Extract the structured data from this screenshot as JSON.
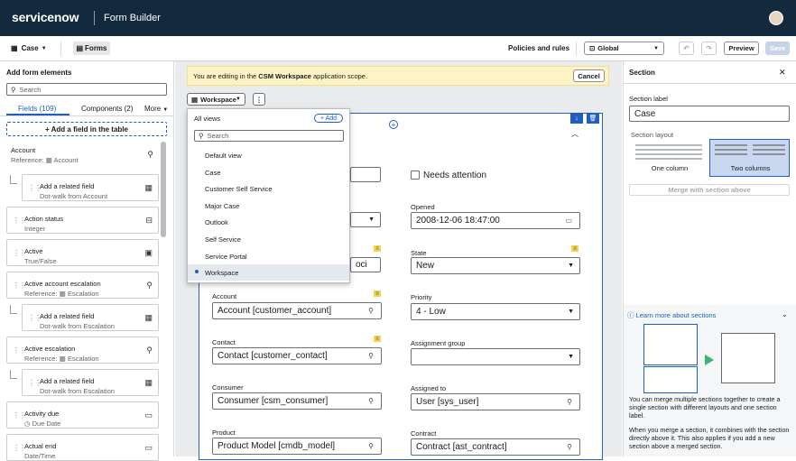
{
  "header": {
    "logo": "servicenow",
    "title": "Form Builder"
  },
  "toolbar": {
    "table": "Case",
    "forms": "Forms",
    "policies": "Policies and rules",
    "scope": "Global",
    "preview": "Preview",
    "save": "Save"
  },
  "left": {
    "title": "Add form elements",
    "search_placeholder": "Search",
    "tabs": [
      "Fields (109)",
      "Components (2)",
      "More"
    ],
    "add_field": "+ Add a field in the table",
    "items": [
      {
        "t1": "Account",
        "t2": "Reference:",
        "t3": "Account",
        "icon": "search-icon"
      },
      {
        "t1": "Add a related field",
        "t2": "Dot-walk from Account",
        "icon": "table-icon"
      },
      {
        "t1": "Action status",
        "t2": "Integer",
        "icon": "integer-icon"
      },
      {
        "t1": "Active",
        "t2": "True/False",
        "icon": "toggle-icon"
      },
      {
        "t1": "Active account escalation",
        "t2": "Reference:",
        "t3": "Escalation",
        "icon": "search-icon"
      },
      {
        "t1": "Add a related field",
        "t2": "Dot-walk from Escalation",
        "icon": "table-icon"
      },
      {
        "t1": "Active escalation",
        "t2": "Reference:",
        "t3": "Escalation",
        "icon": "search-icon"
      },
      {
        "t1": "Add a related field",
        "t2": "Dot-walk from Escalation",
        "icon": "table-icon"
      },
      {
        "t1": "Activity due",
        "t2": "Due Date",
        "icon": "calendar-icon"
      },
      {
        "t1": "Actual end",
        "t2": "Date/Time",
        "icon": "datetime-icon"
      }
    ]
  },
  "banner": {
    "pre": "You are editing in the ",
    "app": "CSM Workspace",
    "post": " application scope.",
    "cancel": "Cancel"
  },
  "view_select": "Workspace",
  "dropdown": {
    "title": "All views",
    "add": "+ Add",
    "search_placeholder": "Search",
    "items": [
      "Default view",
      "Case",
      "Customer Self Service",
      "Major Case",
      "Outlook",
      "Self Service",
      "Service Portal",
      "Workspace"
    ]
  },
  "form": {
    "needs_attention": "Needs attention",
    "opened_label": "Opened",
    "opened_value": "2008-12-06 18:47:00",
    "state_label": "State",
    "state_value": "New",
    "partial_value": "oci",
    "account_label": "Account",
    "account_value": "Account [customer_account]",
    "priority_label": "Priority",
    "priority_value": "4 - Low",
    "contact_label": "Contact",
    "contact_value": "Contact [customer_contact]",
    "assignment_label": "Assignment group",
    "assignment_value": "",
    "consumer_label": "Consumer",
    "consumer_value": "Consumer [csm_consumer]",
    "assigned_label": "Assigned to",
    "assigned_value": "User [sys_user]",
    "product_label": "Product",
    "product_value": "Product Model [cmdb_model]",
    "contract_label": "Contract",
    "contract_value": "Contract [ast_contract]"
  },
  "right": {
    "title": "Section",
    "section_label": "Section label",
    "section_value": "Case",
    "layout_label": "Section layout",
    "one_col": "One column",
    "two_col": "Two columns",
    "merge": "Merge with section above",
    "learn": "Learn more about sections",
    "p1": "You can merge multiple sections together to create a single section with different layouts and one section label.",
    "p2": "When you merge a section, it combines with the section directly above it. This also applies if you add a new section above a merged section."
  },
  "colors": {
    "topbar": "#13293d",
    "accent": "#1f5fbf",
    "banner": "#fdf3c4",
    "flag": "#f6d34a"
  }
}
